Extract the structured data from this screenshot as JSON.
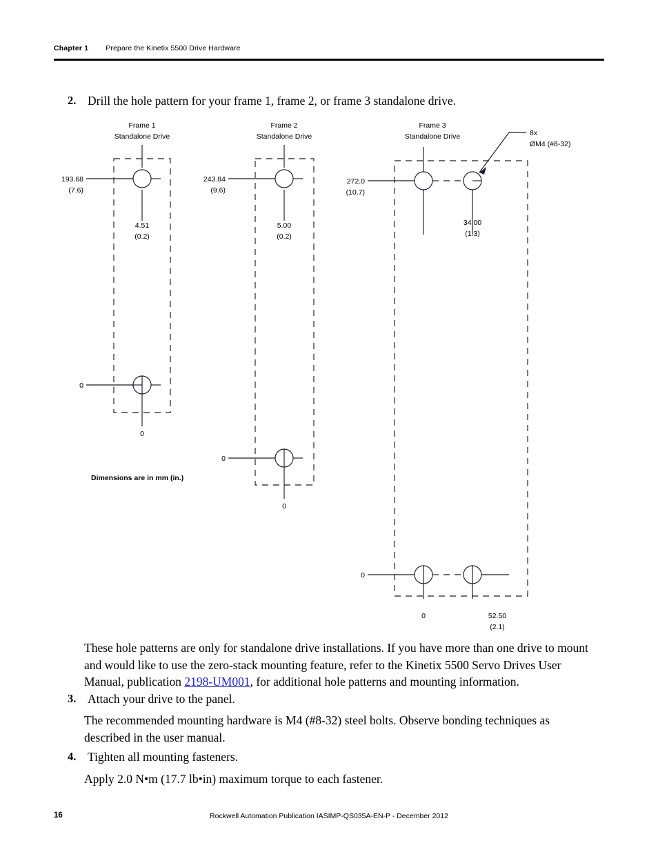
{
  "header": {
    "chapter_label": "Chapter 1",
    "chapter_title": "Prepare the Kinetix 5500 Drive Hardware"
  },
  "steps": [
    {
      "number": "2.",
      "text": "Drill the hole pattern for your frame 1, frame 2, or frame 3 standalone drive."
    },
    {
      "number": "3.",
      "text": "Attach your drive to the panel."
    },
    {
      "number": "4.",
      "text": "Tighten all mounting fasteners."
    }
  ],
  "paragraphs": {
    "hole_pattern_note_part1": "These hole patterns are only for standalone drive installations. If you have more than one drive to mount and would like to use the zero-stack mounting feature, refer to the Kinetix 5500 Servo Drives User Manual, publication ",
    "hole_pattern_link": "2198-UM001",
    "hole_pattern_note_part2": ", for additional hole patterns and mounting information.",
    "mounting_hardware": "The recommended mounting hardware is M4 (#8-32) steel bolts. Observe bonding techniques as described in the user manual.",
    "torque": "Apply 2.0 N•m (17.7 lb•in) maximum torque to each fastener."
  },
  "figure": {
    "dimensions_note": "Dimensions are in mm (in.)",
    "callout": {
      "line1": "8x",
      "line2": "ØM4 (#8-32)"
    },
    "frames": [
      {
        "title_line1": "Frame 1",
        "title_line2": "Standalone Drive",
        "vertical_dim": {
          "mm": "193.68",
          "inch": "(7.6)"
        },
        "horizontal_dim": {
          "mm": "4.51",
          "inch": "(0.2)"
        },
        "origin_left": "0",
        "origin_bottom": "0",
        "hole_count": 2
      },
      {
        "title_line1": "Frame 2",
        "title_line2": "Standalone Drive",
        "vertical_dim": {
          "mm": "243.84",
          "inch": "(9.6)"
        },
        "horizontal_dim": {
          "mm": "5.00",
          "inch": "(0.2)"
        },
        "origin_left": "0",
        "origin_bottom": "0",
        "hole_count": 2
      },
      {
        "title_line1": "Frame 3",
        "title_line2": "Standalone Drive",
        "vertical_dim": {
          "mm": "272.0",
          "inch": "(10.7)"
        },
        "horizontal_dim": {
          "mm": "34.00",
          "inch": "(1.3)"
        },
        "origin_left": "0",
        "origin_bottom": "0",
        "bottom_right_dim": {
          "mm": "52.50",
          "inch": "(2.1)"
        },
        "hole_count": 4
      }
    ]
  },
  "footer": {
    "page_number": "16",
    "publication": "Rockwell Automation Publication IASIMP-QS035A-EN-P - December 2012"
  },
  "colors": {
    "text": "#000000",
    "link": "#2222cc",
    "rule": "#000000"
  }
}
